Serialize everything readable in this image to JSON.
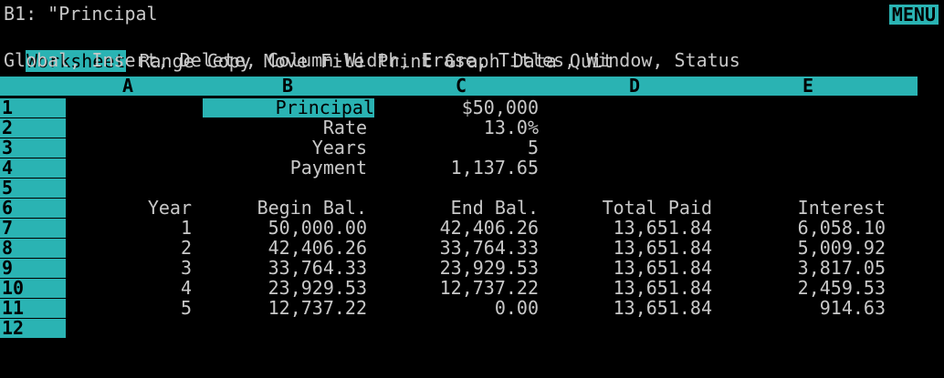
{
  "status": {
    "cell_ref": "B1: \"Principal",
    "mode": "MENU"
  },
  "menu": {
    "items": [
      {
        "label": "Worksheet",
        "active": true
      },
      {
        "label": "Range"
      },
      {
        "label": "Copy"
      },
      {
        "label": "Move"
      },
      {
        "label": "File"
      },
      {
        "label": "Print"
      },
      {
        "label": "Graph"
      },
      {
        "label": "Data"
      },
      {
        "label": "Quit"
      }
    ],
    "description": "Global, Insert, Delete, Column-Width, Erase, Titles, Window, Status"
  },
  "columns": [
    "A",
    "B",
    "C",
    "D",
    "E"
  ],
  "rows": [
    "1",
    "2",
    "3",
    "4",
    "5",
    "6",
    "7",
    "8",
    "9",
    "10",
    "11",
    "12"
  ],
  "inputs": {
    "principal_label": "Principal",
    "principal_value": "$50,000",
    "rate_label": "Rate",
    "rate_value": "13.0%",
    "years_label": "Years",
    "years_value": "5",
    "payment_label": "Payment",
    "payment_value": "1,137.65"
  },
  "table": {
    "headers": [
      "Year",
      "Begin Bal.",
      "End Bal.",
      "Total Paid",
      "Interest"
    ],
    "rows": [
      [
        "1",
        "50,000.00",
        "42,406.26",
        "13,651.84",
        "6,058.10"
      ],
      [
        "2",
        "42,406.26",
        "33,764.33",
        "13,651.84",
        "5,009.92"
      ],
      [
        "3",
        "33,764.33",
        "23,929.53",
        "13,651.84",
        "3,817.05"
      ],
      [
        "4",
        "23,929.53",
        "12,737.22",
        "13,651.84",
        "2,459.53"
      ],
      [
        "5",
        "12,737.22",
        "0.00",
        "13,651.84",
        "914.63"
      ]
    ]
  }
}
